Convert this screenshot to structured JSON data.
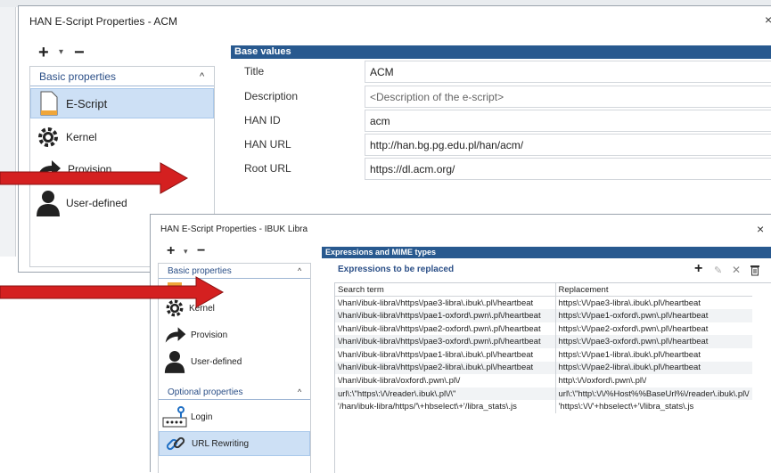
{
  "win1": {
    "title": "HAN E-Script Properties - ACM",
    "close": "×",
    "toolbar": {
      "add": "+",
      "dropdown": "▾",
      "remove": "−"
    },
    "sidebar": {
      "section": "Basic properties",
      "chevron": "^",
      "items": [
        {
          "label": "E-Script"
        },
        {
          "label": "Kernel"
        },
        {
          "label": "Provision"
        },
        {
          "label": "User-defined"
        }
      ]
    },
    "main": {
      "bar": "Base values",
      "fields": [
        {
          "label": "Title",
          "value": "ACM"
        },
        {
          "label": "Description",
          "value": "<Description of the e-script>"
        },
        {
          "label": "HAN ID",
          "value": "acm"
        },
        {
          "label": "HAN URL",
          "value": "http://han.bg.pg.edu.pl/han/acm/"
        },
        {
          "label": "Root URL",
          "value": "https://dl.acm.org/"
        }
      ]
    }
  },
  "win2": {
    "title": "HAN E-Script Properties - IBUK Libra",
    "close": "×",
    "toolbar": {
      "add": "+",
      "dropdown": "▾",
      "remove": "−"
    },
    "sidebar": {
      "section1": "Basic properties",
      "section2": "Optional properties",
      "chevron": "^",
      "items": [
        {
          "label": "Kernel"
        },
        {
          "label": "Provision"
        },
        {
          "label": "User-defined"
        },
        {
          "label": "Login"
        },
        {
          "label": "URL Rewriting"
        }
      ]
    },
    "main": {
      "bar": "Expressions and MIME types",
      "subheader": "Expressions to be replaced",
      "actions": {
        "add": "+",
        "edit": "✎",
        "delete": "✕",
        "trash": "🗑"
      },
      "columns": [
        "Search term",
        "Replacement"
      ],
      "rows": [
        [
          "\\/han\\/ibuk-libra\\/https\\/pae3-libra\\.ibuk\\.pl\\/heartbeat",
          "https\\:\\/\\/pae3-libra\\.ibuk\\.pl\\/heartbeat"
        ],
        [
          "\\/han\\/ibuk-libra\\/https\\/pae1-oxford\\.pwn\\.pl\\/heartbeat",
          "https\\:\\/\\/pae1-oxford\\.pwn\\.pl\\/heartbeat"
        ],
        [
          "\\/han\\/ibuk-libra\\/https\\/pae2-oxford\\.pwn\\.pl\\/heartbeat",
          "https\\:\\/\\/pae2-oxford\\.pwn\\.pl\\/heartbeat"
        ],
        [
          "\\/han\\/ibuk-libra\\/https\\/pae3-oxford\\.pwn\\.pl\\/heartbeat",
          "https\\:\\/\\/pae3-oxford\\.pwn\\.pl\\/heartbeat"
        ],
        [
          "\\/han\\/ibuk-libra\\/https\\/pae1-libra\\.ibuk\\.pl\\/heartbeat",
          "https\\:\\/\\/pae1-libra\\.ibuk\\.pl\\/heartbeat"
        ],
        [
          "\\/han\\/ibuk-libra\\/https\\/pae2-libra\\.ibuk\\.pl\\/heartbeat",
          "https\\:\\/\\/pae2-libra\\.ibuk\\.pl\\/heartbeat"
        ],
        [
          "\\/han\\/ibuk-libra\\/oxford\\.pwn\\.pl\\/",
          "http\\:\\/\\/oxford\\.pwn\\.pl\\/"
        ],
        [
          "url\\:\\\"https\\:\\/\\/reader\\.ibuk\\.pl\\/\\\"",
          "url\\:\\\"http\\:\\/\\/%Host%%BaseUrl%\\/reader\\.ibuk\\.pl\\/"
        ],
        [
          "'/han/ibuk-libra/https/'\\+hbselect\\+'/libra_stats\\.js",
          "'https\\:\\/\\/'+hbselect\\+'\\/libra_stats\\.js"
        ]
      ]
    }
  },
  "colors": {
    "accent_bar": "#28598f",
    "arrow": "#d42020",
    "selected": "#cde0f5",
    "section_text": "#2b4f87"
  }
}
